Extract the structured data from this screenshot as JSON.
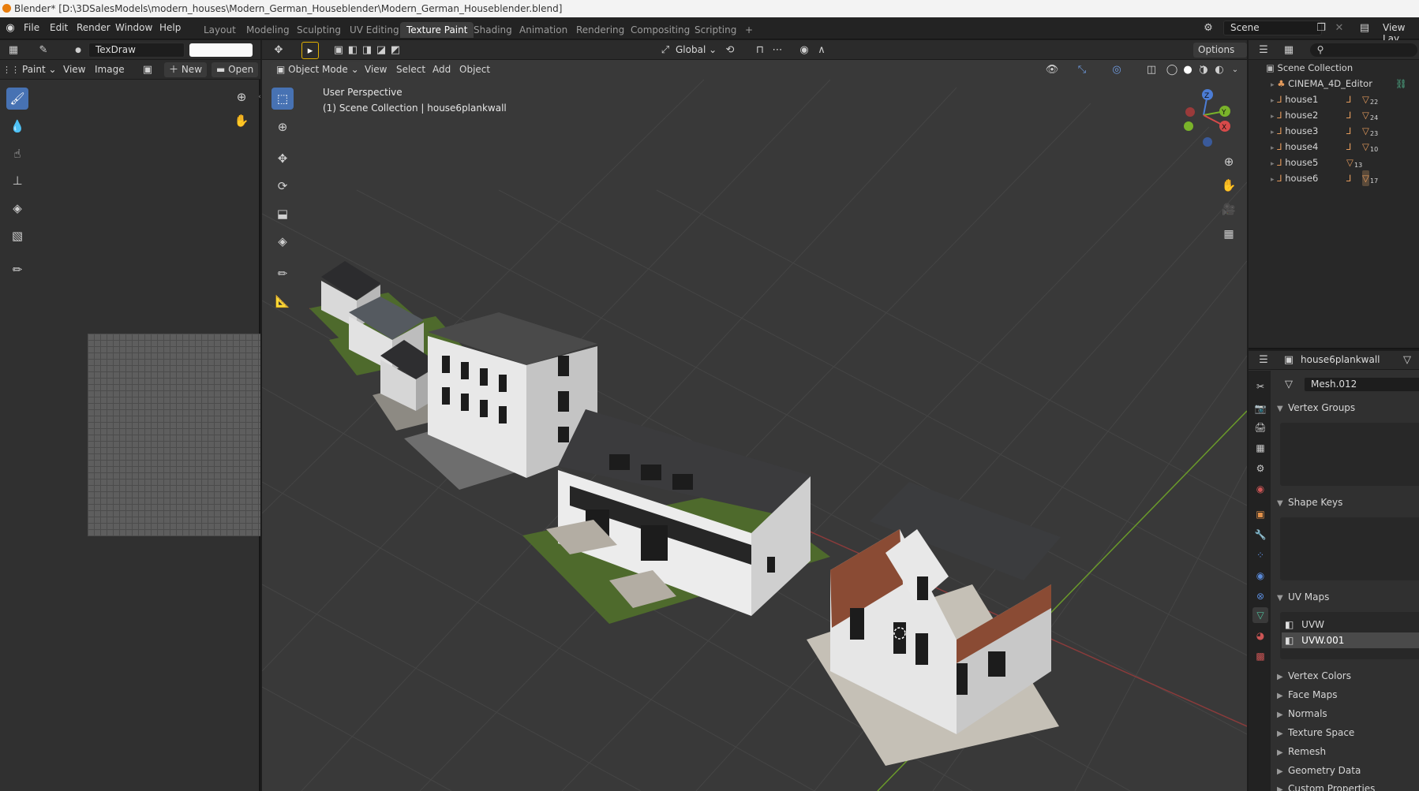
{
  "window": {
    "title": "Blender* [D:\\3DSalesModels\\modern_houses\\Modern_German_Houseblender\\Modern_German_Houseblender.blend]"
  },
  "menu": [
    "File",
    "Edit",
    "Render",
    "Window",
    "Help"
  ],
  "workspaces": [
    "Layout",
    "Modeling",
    "Sculpting",
    "UV Editing",
    "Texture Paint",
    "Shading",
    "Animation",
    "Rendering",
    "Compositing",
    "Scripting",
    "+"
  ],
  "active_workspace": "Texture Paint",
  "scene": {
    "name": "Scene",
    "view_layer": "View Lay"
  },
  "image_editor": {
    "brush_name": "TexDraw",
    "mode": "Paint",
    "menus": [
      "View",
      "Image"
    ],
    "new_label": "New",
    "open_label": "Open"
  },
  "viewport": {
    "mode": "Object Mode",
    "menus": [
      "View",
      "Select",
      "Add",
      "Object"
    ],
    "transform_orientation": "Global",
    "options_label": "Options",
    "perspective": "User Perspective",
    "collection_info": "(1) Scene Collection | house6plankwall",
    "gizmo_axes": [
      "Z",
      "Y",
      "X"
    ]
  },
  "outliner": {
    "root": "Scene Collection",
    "items": [
      {
        "name": "CINEMA_4D_Editor",
        "badge": ""
      },
      {
        "name": "house1",
        "badge": "22"
      },
      {
        "name": "house2",
        "badge": "24"
      },
      {
        "name": "house3",
        "badge": "23"
      },
      {
        "name": "house4",
        "badge": "10"
      },
      {
        "name": "house5",
        "badge": "13"
      },
      {
        "name": "house6",
        "badge": "17"
      }
    ]
  },
  "properties": {
    "object_name": "house6plankwall",
    "mesh_name": "Mesh.012",
    "sections_open": [
      "Vertex Groups",
      "Shape Keys",
      "UV Maps"
    ],
    "uv_maps": [
      "UVW",
      "UVW.001"
    ],
    "active_uv": "UVW.001",
    "sections_closed": [
      "Vertex Colors",
      "Face Maps",
      "Normals",
      "Texture Space",
      "Remesh",
      "Geometry Data",
      "Custom Properties"
    ]
  },
  "colors": {
    "accent": "#4772b3",
    "object_orange": "#e39a5c",
    "grid_green": "#6a9a2a",
    "grid_red": "#9a3a3a"
  }
}
